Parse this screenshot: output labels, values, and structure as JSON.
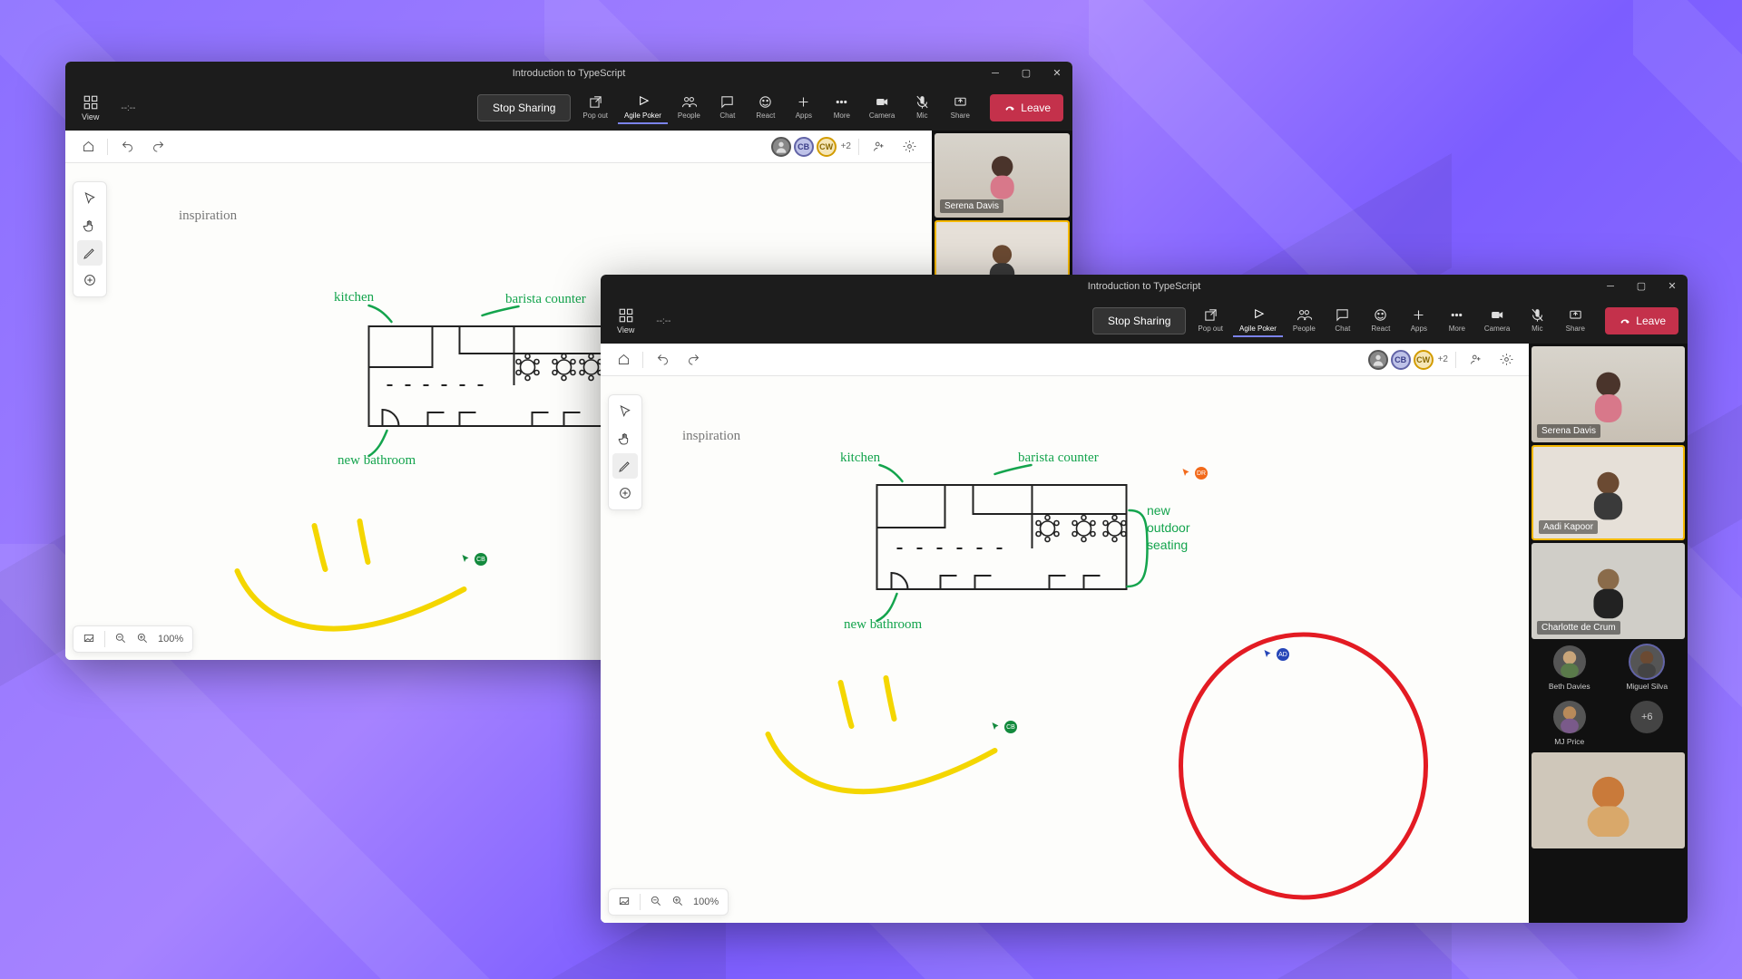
{
  "window_title": "Introduction to TypeScript",
  "view_label": "View",
  "time_placeholder": "--:--",
  "stop_sharing": "Stop Sharing",
  "toolbar": [
    {
      "id": "popout",
      "label": "Pop out"
    },
    {
      "id": "agile",
      "label": "Agile Poker",
      "active": true
    },
    {
      "id": "people",
      "label": "People"
    },
    {
      "id": "chat",
      "label": "Chat"
    },
    {
      "id": "react",
      "label": "React"
    },
    {
      "id": "apps",
      "label": "Apps"
    },
    {
      "id": "more",
      "label": "More"
    },
    {
      "id": "camera",
      "label": "Camera"
    },
    {
      "id": "mic",
      "label": "Mic"
    },
    {
      "id": "share",
      "label": "Share"
    }
  ],
  "leave": "Leave",
  "overflow_count": "+2",
  "zoom": "100%",
  "annotations": {
    "inspiration": "inspiration",
    "kitchen": "kitchen",
    "barista": "barista counter",
    "outdoor1": "new",
    "outdoor2": "outdoor",
    "outdoor3": "seating",
    "bathroom": "new bathroom"
  },
  "participants_large": [
    {
      "name": "Serena Davis"
    },
    {
      "name": "Aadi Kapoor",
      "speaking": true
    },
    {
      "name": "Charlotte de Crum"
    }
  ],
  "participants_small": [
    {
      "name": "Beth Davies"
    },
    {
      "name": "Miguel Silva",
      "ring": true
    },
    {
      "name": "MJ Price"
    }
  ],
  "more_count": "+6",
  "w1_participants": [
    {
      "name": "Serena Davis"
    }
  ]
}
